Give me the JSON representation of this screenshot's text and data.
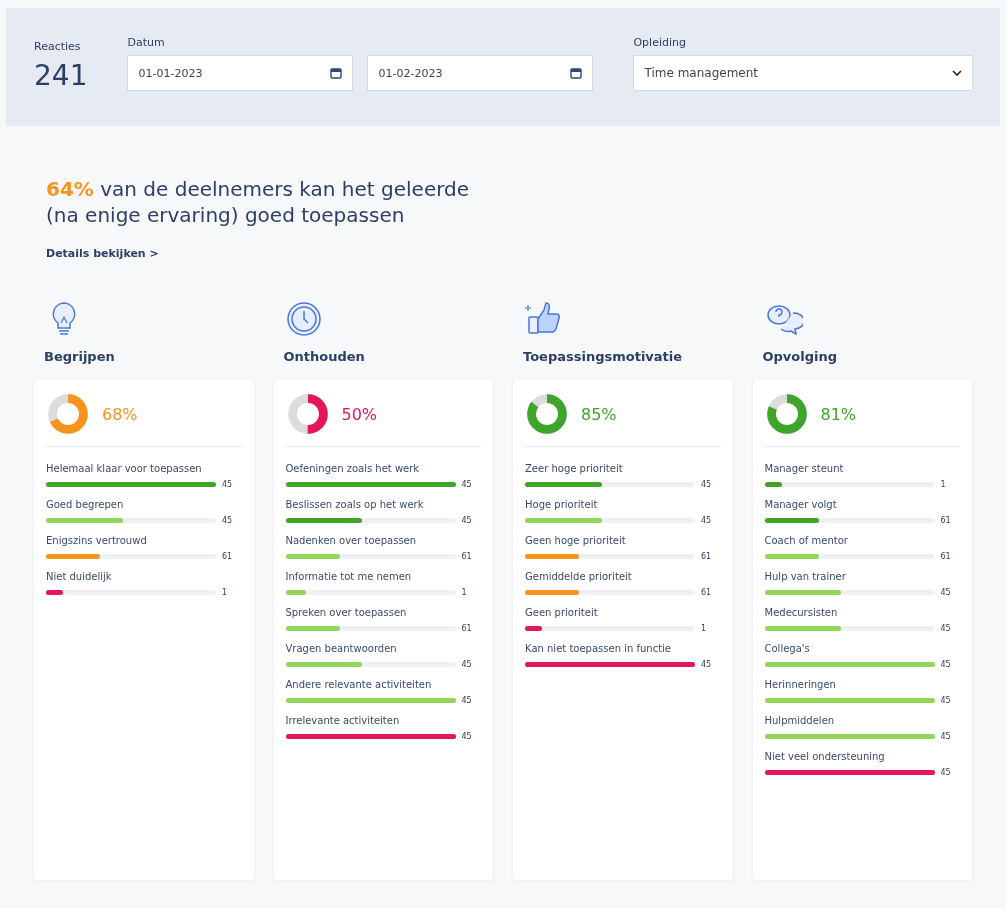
{
  "summary": {
    "label": "Reacties",
    "value": "241"
  },
  "filters": {
    "date_label": "Datum",
    "date_from": "01-01-2023",
    "date_to": "01-02-2023",
    "course_label": "Opleiding",
    "course": "Time management"
  },
  "headline": {
    "highlight": "64%",
    "text": " van de deelnemers kan het geleerde (na enige ervaring) goed toepassen",
    "link": "Details bekijken >"
  },
  "categories": [
    {
      "kind": "bulb",
      "title": "Begrijpen",
      "percent": "68%",
      "level": 0.68,
      "color": "#f7941d",
      "items": [
        {
          "label": "Helemaal klaar voor toepassen",
          "count": "45",
          "level": 1.0,
          "color": "#3fa52a"
        },
        {
          "label": "Goed begrepen",
          "count": "45",
          "level": 0.45,
          "color": "#8fd65a"
        },
        {
          "label": "Enigszins vertrouwd",
          "count": "61",
          "level": 0.32,
          "color": "#f7941d"
        },
        {
          "label": "Niet duidelijk",
          "count": "1",
          "level": 0.1,
          "color": "#e3175a"
        }
      ]
    },
    {
      "kind": "clock",
      "title": "Onthouden",
      "percent": "50%",
      "level": 0.5,
      "color": "#e3175a",
      "items": [
        {
          "label": "Oefeningen zoals het werk",
          "count": "45",
          "level": 1.0,
          "color": "#3fa52a"
        },
        {
          "label": "Beslissen zoals op het werk",
          "count": "45",
          "level": 0.45,
          "color": "#3fa52a"
        },
        {
          "label": "Nadenken over toepassen",
          "count": "61",
          "level": 0.32,
          "color": "#8fd65a"
        },
        {
          "label": "Informatie tot me nemen",
          "count": "1",
          "level": 0.12,
          "color": "#8fd65a"
        },
        {
          "label": "Spreken over toepassen",
          "count": "61",
          "level": 0.32,
          "color": "#8fd65a"
        },
        {
          "label": "Vragen beantwoorden",
          "count": "45",
          "level": 0.45,
          "color": "#8fd65a"
        },
        {
          "label": "Andere relevante activiteiten",
          "count": "45",
          "level": 1.0,
          "color": "#8fd65a"
        },
        {
          "label": "Irrelevante activiteiten",
          "count": "45",
          "level": 1.0,
          "color": "#e3175a"
        }
      ]
    },
    {
      "kind": "thumb",
      "title": "Toepassingsmotivatie",
      "percent": "85%",
      "level": 0.85,
      "color": "#3fa52a",
      "items": [
        {
          "label": "Zeer hoge prioriteit",
          "count": "45",
          "level": 0.45,
          "color": "#3fa52a"
        },
        {
          "label": "Hoge prioriteit",
          "count": "45",
          "level": 0.45,
          "color": "#8fd65a"
        },
        {
          "label": "Geen hoge prioriteit",
          "count": "61",
          "level": 0.32,
          "color": "#f7941d"
        },
        {
          "label": "Gemiddelde prioriteit",
          "count": "61",
          "level": 0.32,
          "color": "#f7941d"
        },
        {
          "label": "Geen prioriteit",
          "count": "1",
          "level": 0.1,
          "color": "#e3175a"
        },
        {
          "label": "Kan niet toepassen in functie",
          "count": "45",
          "level": 1.0,
          "color": "#e3175a"
        }
      ]
    },
    {
      "kind": "chat",
      "title": "Opvolging",
      "percent": "81%",
      "level": 0.81,
      "color": "#3fa52a",
      "items": [
        {
          "label": "Manager steunt",
          "count": "1",
          "level": 0.1,
          "color": "#3fa52a"
        },
        {
          "label": "Manager volgt",
          "count": "61",
          "level": 0.32,
          "color": "#3fa52a"
        },
        {
          "label": "Coach of mentor",
          "count": "61",
          "level": 0.32,
          "color": "#8fd65a"
        },
        {
          "label": "Hulp van trainer",
          "count": "45",
          "level": 0.45,
          "color": "#8fd65a"
        },
        {
          "label": "Medecursisten",
          "count": "45",
          "level": 0.45,
          "color": "#8fd65a"
        },
        {
          "label": "Collega's",
          "count": "45",
          "level": 1.0,
          "color": "#8fd65a"
        },
        {
          "label": "Herinneringen",
          "count": "45",
          "level": 1.0,
          "color": "#8fd65a"
        },
        {
          "label": "Hulpmiddelen",
          "count": "45",
          "level": 1.0,
          "color": "#8fd65a"
        },
        {
          "label": "Niet veel ondersteuning",
          "count": "45",
          "level": 1.0,
          "color": "#e3175a"
        }
      ]
    }
  ]
}
